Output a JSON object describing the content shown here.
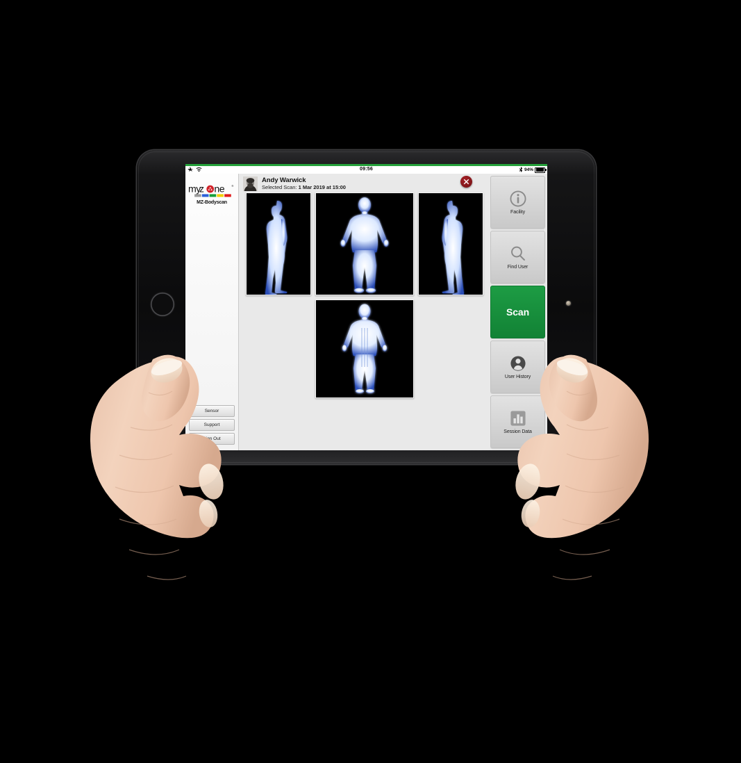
{
  "status_bar": {
    "airplane_icon": "airplane-icon",
    "wifi_icon": "wifi-icon",
    "time": "09:56",
    "bluetooth_icon": "bluetooth-icon",
    "battery_percent": "94%",
    "recording_strip_color": "#25a13a"
  },
  "sidebar_left": {
    "logo_text": "myzone",
    "logo_tagline": "MZ-Bodyscan",
    "logo_colors": [
      "#9b9b9b",
      "#2b5fd9",
      "#17a03a",
      "#f2d000",
      "#e01b1b"
    ],
    "logo_mark_color": "#d2232a",
    "buttons": [
      {
        "label": "Sensor",
        "name": "sensor-button"
      },
      {
        "label": "Support",
        "name": "support-button"
      },
      {
        "label": "Sign Out",
        "name": "sign-out-button"
      }
    ]
  },
  "user": {
    "name": "Andy Warwick",
    "scan_label": "Selected Scan:",
    "scan_date": "1 Mar 2019 at 15:00",
    "avatar_name": "user-avatar-photo"
  },
  "close_button": {
    "label": "close",
    "color": "#8f181d"
  },
  "scans": {
    "thumbnails": [
      {
        "name": "scan-thumbnail-left-side",
        "view": "left-side"
      },
      {
        "name": "scan-thumbnail-front",
        "view": "front"
      },
      {
        "name": "scan-thumbnail-right-side",
        "view": "right-side"
      },
      {
        "name": "scan-thumbnail-back",
        "view": "back"
      }
    ]
  },
  "sidebar_right": {
    "buttons": [
      {
        "label": "Facility",
        "icon": "info-circle-icon",
        "name": "facility-button",
        "accent": "#8a8a8a"
      },
      {
        "label": "Find User",
        "icon": "search-icon",
        "name": "find-user-button",
        "accent": "#8a8a8a"
      },
      {
        "label": "Scan",
        "icon": "none",
        "name": "scan-button",
        "accent": "#17913c"
      },
      {
        "label": "User History",
        "icon": "person-circle-icon",
        "name": "user-history-button",
        "accent": "#4a4a4a"
      },
      {
        "label": "Session Data",
        "icon": "bar-chart-icon",
        "name": "session-data-button",
        "accent": "#9a9a9a"
      }
    ]
  },
  "device": {
    "bezel_color": "#0b0b0c",
    "home_button": "home-button",
    "camera": "front-camera-dot"
  },
  "decor": {
    "legs_wireframe": "wireframe-legs-mesh",
    "left_hand": "left-hand-photo",
    "right_hand": "right-hand-photo"
  }
}
